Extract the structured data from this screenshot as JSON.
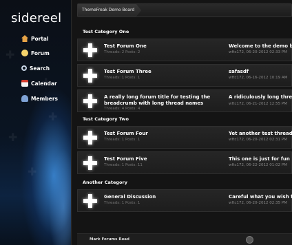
{
  "sidebar": {
    "logo": "sidereel",
    "items": [
      {
        "label": "Portal",
        "icon": "home-icon",
        "color": "#e6a347"
      },
      {
        "label": "Forum",
        "icon": "speech-bubble-icon",
        "color": "#f5d36b"
      },
      {
        "label": "Search",
        "icon": "magnifier-icon",
        "color": "#c8d6e6"
      },
      {
        "label": "Calendar",
        "icon": "calendar-icon",
        "color": "#d33b2c"
      },
      {
        "label": "Members",
        "icon": "people-icon",
        "color": "#7fa3d6"
      }
    ]
  },
  "breadcrumb": {
    "current": "ThemeFreak Demo Board"
  },
  "categories": [
    {
      "title": "Test Category One",
      "forums": [
        {
          "title": "Test Forum One",
          "stats": "Threads: 2 Posts: 2",
          "last_title": "Welcome to the demo board",
          "last_meta": "wftc172, 06-20-2012 02:33 PM"
        },
        {
          "title": "Test Forum Three",
          "stats": "Threads: 1 Posts: 1",
          "last_title": "safasdf",
          "last_meta": "wftc172, 06-16-2012 10:19 AM"
        },
        {
          "title": "A really long forum title for testing the breadcrumb with long thread names",
          "stats": "Threads: 4 Posts: 4",
          "last_title": "A ridiculously long thread for",
          "last_meta": "wftc172, 06-21-2012 12:55 PM"
        }
      ]
    },
    {
      "title": "Test Category Two",
      "forums": [
        {
          "title": "Test Forum Four",
          "stats": "Threads: 1 Posts: 1",
          "last_title": "Yet another test thread",
          "last_meta": "wftc172, 06-20-2012 02:31 PM"
        },
        {
          "title": "Test Forum Five",
          "stats": "Threads: 1 Posts: 11",
          "last_title": "This one is just for fun",
          "last_meta": "wftc172, 06-22-2012 01:02 PM"
        }
      ]
    },
    {
      "title": "Another Category",
      "forums": [
        {
          "title": "General Discussion",
          "stats": "Threads: 1 Posts: 1",
          "last_title": "Careful what you wish for",
          "last_meta": "wftc172, 06-20-2012 02:35 PM"
        }
      ]
    }
  ],
  "footer": {
    "mark_read": "Mark Forums Read"
  }
}
